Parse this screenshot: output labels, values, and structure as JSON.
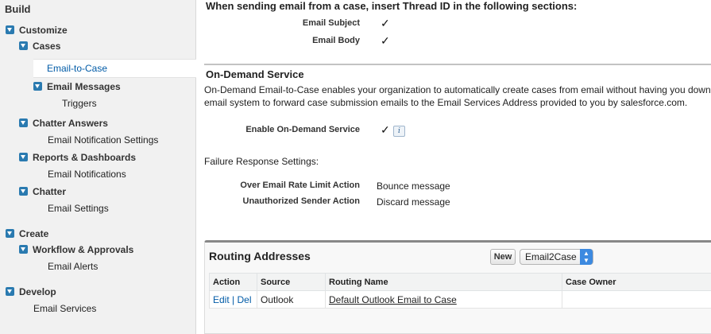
{
  "sidebar": {
    "build_heading": "Build",
    "customize": "Customize",
    "cases": "Cases",
    "email_to_case": "Email-to-Case",
    "email_messages": "Email Messages",
    "triggers": "Triggers",
    "chatter_answers": "Chatter Answers",
    "email_notification_settings": "Email Notification Settings",
    "reports_dashboards": "Reports & Dashboards",
    "email_notifications": "Email Notifications",
    "chatter": "Chatter",
    "email_settings": "Email Settings",
    "create": "Create",
    "workflow_approvals": "Workflow & Approvals",
    "email_alerts": "Email Alerts",
    "develop": "Develop",
    "email_services": "Email Services"
  },
  "main": {
    "thread_heading": "When sending email from a case, insert Thread ID in the following sections:",
    "email_subject_label": "Email Subject",
    "email_body_label": "Email Body",
    "check_glyph": "✓",
    "on_demand_heading": "On-Demand Service",
    "on_demand_desc_1": "On-Demand Email-to-Case enables your organization to automatically create cases from email without having you download",
    "on_demand_desc_2": "email system to forward case submission emails to the Email Services Address provided to you by salesforce.com.",
    "enable_on_demand_label": "Enable On-Demand Service",
    "info_glyph": "i",
    "failure_settings": "Failure Response Settings:",
    "over_limit_label": "Over Email Rate Limit Action",
    "over_limit_value": "Bounce message",
    "unauth_sender_label": "Unauthorized Sender Action",
    "unauth_sender_value": "Discard message"
  },
  "routing": {
    "title": "Routing Addresses",
    "new_button": "New",
    "select_value": "Email2Case",
    "columns": [
      "Action",
      "Source",
      "Routing Name",
      "Case Owner"
    ],
    "rows": [
      {
        "action_edit": "Edit",
        "action_sep": "|",
        "action_del": "Del",
        "source": "Outlook",
        "routing_name": "Default Outlook Email to Case",
        "case_owner": ""
      }
    ]
  }
}
